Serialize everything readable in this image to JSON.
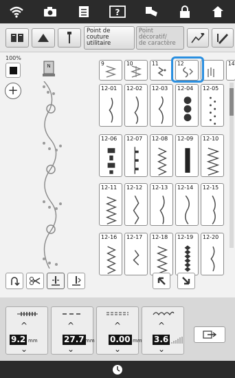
{
  "tabs": {
    "utility_label": "Point de\ncouture\nutilitaire",
    "decorative_label": "Point\ndécoratif/\nde caractère"
  },
  "zoom": "100%",
  "stitch_headers": [
    "9",
    "10",
    "11",
    "12",
    "14"
  ],
  "stitch_cells": [
    [
      "12-01",
      "12-02",
      "12-03",
      "12-04",
      "12-05"
    ],
    [
      "12-06",
      "12-07",
      "12-08",
      "12-09",
      "12-10"
    ],
    [
      "12-11",
      "12-12",
      "12-13",
      "12-14",
      "12-15"
    ],
    [
      "12-16",
      "12-17",
      "12-18",
      "12-19",
      "12-20"
    ]
  ],
  "settings": {
    "width_value": "9.2",
    "width_unit": "mm",
    "length_value": "27.7",
    "length_unit": "mm",
    "offset_value": "0.00",
    "offset_unit": "mm",
    "tension_value": "3.6"
  },
  "icons": {
    "wifi": "wifi-icon",
    "camera": "camera-icon",
    "document": "document-icon",
    "help": "help-icon",
    "thread": "thread-icon",
    "lock": "lock-icon",
    "home": "home-icon"
  }
}
